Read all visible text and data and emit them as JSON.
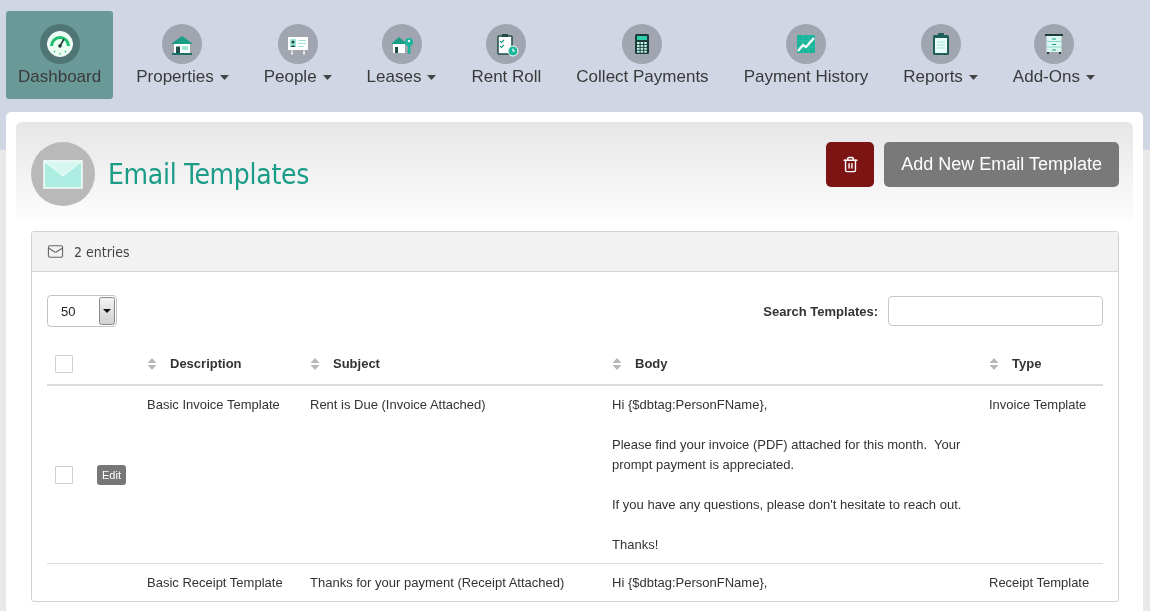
{
  "nav": {
    "items": [
      {
        "label": "Dashboard",
        "selected": true,
        "has_menu": false
      },
      {
        "label": "Properties",
        "selected": false,
        "has_menu": true
      },
      {
        "label": "People",
        "selected": false,
        "has_menu": true
      },
      {
        "label": "Leases",
        "selected": false,
        "has_menu": true
      },
      {
        "label": "Rent Roll",
        "selected": false,
        "has_menu": false
      },
      {
        "label": "Collect Payments",
        "selected": false,
        "has_menu": false
      },
      {
        "label": "Payment History",
        "selected": false,
        "has_menu": false
      },
      {
        "label": "Reports",
        "selected": false,
        "has_menu": true
      },
      {
        "label": "Add-Ons",
        "selected": false,
        "has_menu": true
      }
    ]
  },
  "page": {
    "title": "Email Templates",
    "actions": [
      {
        "kind": "delete"
      },
      {
        "kind": "add",
        "label": "Add New Email Template"
      }
    ]
  },
  "panel": {
    "summary": "2 entries",
    "page_size": "50",
    "search_label": "Search Templates:"
  },
  "table": {
    "select_all": {
      "checked": false
    },
    "columns": [
      "Description",
      "Subject",
      "Body",
      "Type"
    ],
    "rows": [
      {
        "checked": false,
        "action": "Edit",
        "description": "Basic Invoice Template",
        "subject": "Rent is Due (Invoice Attached)",
        "body": [
          "Hi {$dbtag:PersonFName},",
          "Please find your invoice (PDF) attached for this month.  Your prompt payment is appreciated.",
          "If you have any questions, please don't hesitate to reach out.",
          "Thanks!"
        ],
        "type": "Invoice Template"
      },
      {
        "description": "Basic Receipt Template",
        "subject": "Thanks for your payment (Receipt Attached)",
        "body": [
          "Hi {$dbtag:PersonFName},"
        ],
        "type": "Receipt Template"
      }
    ]
  }
}
